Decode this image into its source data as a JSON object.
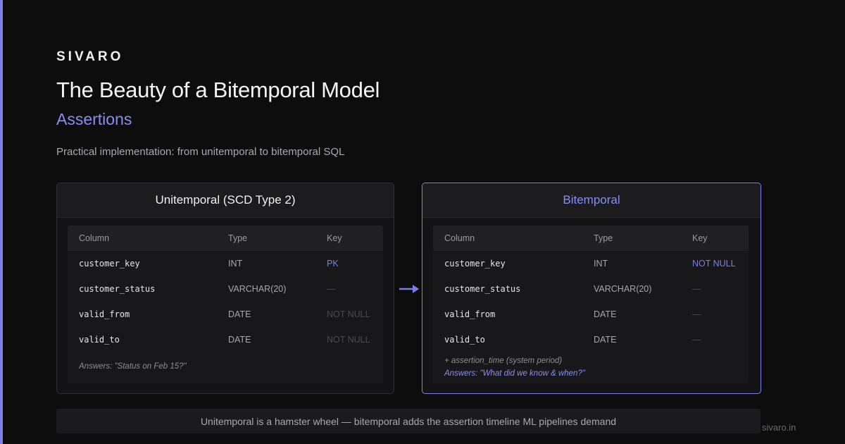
{
  "brand": "SIVARO",
  "title": "The Beauty of a Bitemporal Model",
  "subtitle": "Assertions",
  "description": "Practical implementation: from unitemporal to bitemporal SQL",
  "colors": {
    "accent": "#7b7fe6",
    "background": "#0d0d0e",
    "panel": "#141416"
  },
  "left_panel": {
    "title": "Unitemporal (SCD Type 2)",
    "headers": [
      "Column",
      "Type",
      "Key"
    ],
    "rows": [
      {
        "column": "customer_key",
        "type": "INT",
        "key": "PK"
      },
      {
        "column": "customer_status",
        "type": "VARCHAR(20)",
        "key": "—"
      },
      {
        "column": "valid_from",
        "type": "DATE",
        "key": "NOT NULL"
      },
      {
        "column": "valid_to",
        "type": "DATE",
        "key": "NOT NULL"
      }
    ],
    "note": "Answers: \"Status on Feb 15?\""
  },
  "right_panel": {
    "title": "Bitemporal",
    "headers": [
      "Column",
      "Type",
      "Key"
    ],
    "rows": [
      {
        "column": "customer_key",
        "type": "INT",
        "key": "NOT NULL"
      },
      {
        "column": "customer_status",
        "type": "VARCHAR(20)",
        "key": "—"
      },
      {
        "column": "valid_from",
        "type": "DATE",
        "key": "—"
      },
      {
        "column": "valid_to",
        "type": "DATE",
        "key": "—"
      }
    ],
    "note_1": "+ assertion_time (system period)",
    "note_2": "Answers: \"What did we know & when?\""
  },
  "arrow_icon": "arrow-right-icon",
  "footer": "Unitemporal is a hamster wheel — bitemporal adds the assertion timeline ML pipelines demand",
  "site": "sivaro.in"
}
